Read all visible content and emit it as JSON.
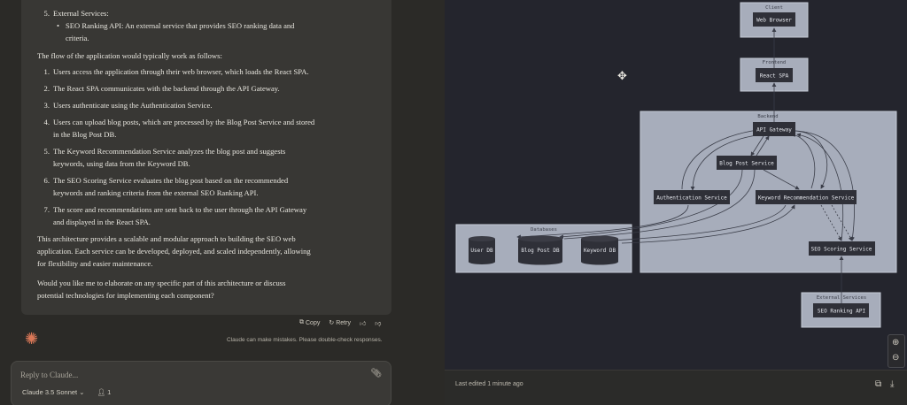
{
  "message": {
    "item5": {
      "num": "5.",
      "label": "External Services:"
    },
    "bullet": "SEO Ranking API: An external service that provides SEO ranking data and",
    "bullet_cont": "criteria.",
    "flow_intro": "The flow of the application would typically work as follows:",
    "steps": [
      {
        "num": "1.",
        "lines": [
          "Users access the application through their web browser, which loads the React SPA."
        ]
      },
      {
        "num": "2.",
        "lines": [
          "The React SPA communicates with the backend through the API Gateway."
        ]
      },
      {
        "num": "3.",
        "lines": [
          "Users authenticate using the Authentication Service."
        ]
      },
      {
        "num": "4.",
        "lines": [
          "Users can upload blog posts, which are processed by the Blog Post Service and stored",
          "in the Blog Post DB."
        ]
      },
      {
        "num": "5.",
        "lines": [
          "The Keyword Recommendation Service analyzes the blog post and suggests",
          "keywords, using data from the Keyword DB."
        ]
      },
      {
        "num": "6.",
        "lines": [
          "The SEO Scoring Service evaluates the blog post based on the recommended",
          "keywords and ranking criteria from the external SEO Ranking API."
        ]
      },
      {
        "num": "7.",
        "lines": [
          "The score and recommendations are sent back to the user through the API Gateway",
          "and displayed in the React SPA."
        ]
      }
    ],
    "summary": [
      "This architecture provides a scalable and modular approach to building the SEO web",
      "application. Each service can be developed, deployed, and scaled independently, allowing",
      "for flexibility and easier maintenance."
    ],
    "question": [
      "Would you like me to elaborate on any specific part of this architecture or discuss",
      "potential technologies for implementing each component?"
    ]
  },
  "actions": {
    "copy": "Copy",
    "retry": "Retry"
  },
  "disclaimer": "Claude can make mistakes. Please double-check responses.",
  "composer": {
    "placeholder": "Reply to Claude...",
    "model": "Claude 3.5 Sonnet",
    "count": "1"
  },
  "artifact": {
    "edited": "Last edited 1 minute ago"
  },
  "diagram": {
    "groups": {
      "client": "Client",
      "frontend": "Frontend",
      "backend": "Backend",
      "databases": "Databases",
      "external": "External Services"
    },
    "nodes": {
      "web_browser": "Web Browser",
      "react_spa": "React SPA",
      "api_gateway": "API Gateway",
      "blog_post_service": "Blog Post Service",
      "auth_service": "Authentication Service",
      "keyword_service": "Keyword Recommendation Service",
      "seo_scoring": "SEO Scoring Service",
      "user_db": "User DB",
      "blog_post_db": "Blog Post DB",
      "keyword_db": "Keyword DB",
      "seo_api": "SEO Ranking API"
    }
  },
  "colors": {
    "accent": "#d97757",
    "group_fill": "#a7adbb",
    "node_fill": "#2f3038"
  }
}
